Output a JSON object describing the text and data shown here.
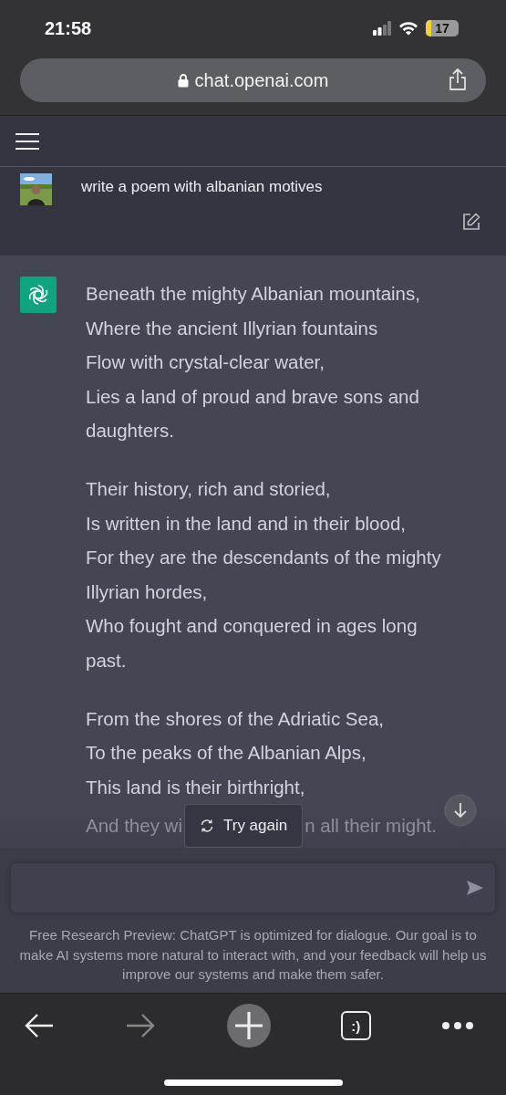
{
  "status_bar": {
    "time": "21:58",
    "battery": "17"
  },
  "address_bar": {
    "url": "chat.openai.com"
  },
  "user_message": {
    "text": "write a poem with albanian motives"
  },
  "assistant_message": {
    "stanzas": [
      [
        "Beneath the mighty Albanian mountains,",
        "Where the ancient Illyrian fountains",
        "Flow with crystal-clear water,",
        "Lies a land of proud and brave sons and daughters."
      ],
      [
        "Their history, rich and storied,",
        "Is written in the land and in their blood,",
        "For they are the descendants of the mighty Illyrian hordes,",
        "Who fought and conquered in ages long past."
      ],
      [
        "From the shores of the Adriatic Sea,",
        "To the peaks of the Albanian Alps,",
        "This land is their birthright,"
      ]
    ],
    "covered_line": {
      "left": "And they wi",
      "right": "n all their might."
    }
  },
  "try_again_button": {
    "label": "Try again"
  },
  "disclaimer": "Free Research Preview: ChatGPT is optimized for dialogue. Our goal is to make AI systems more natural to interact with, and your feedback will help us improve our systems and make them safer.",
  "browser_toolbar": {
    "tabs_label": ":)"
  }
}
